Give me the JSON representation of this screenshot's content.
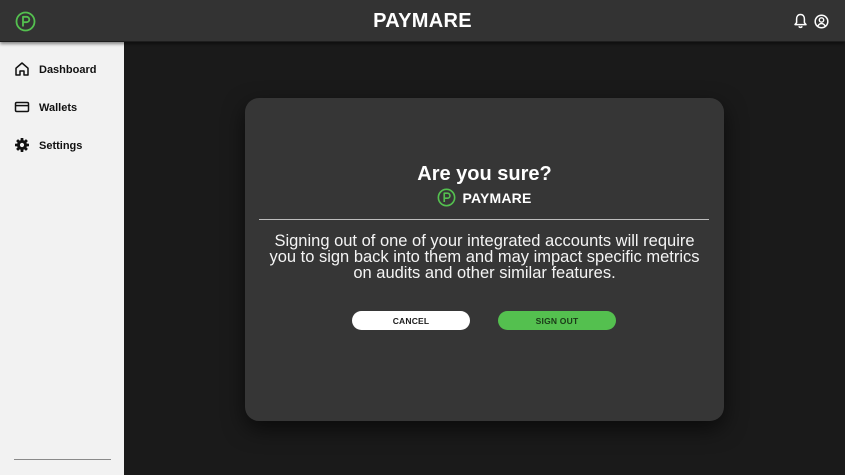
{
  "header": {
    "app_title": "PAYMARE",
    "logo_icon": "paymare-logo-icon",
    "notification_icon": "bell-icon",
    "account_icon": "user-circle-icon"
  },
  "sidebar": {
    "items": [
      {
        "label": "Dashboard",
        "icon": "home-icon"
      },
      {
        "label": "Wallets",
        "icon": "credit-card-icon"
      },
      {
        "label": "Settings",
        "icon": "gear-icon"
      }
    ]
  },
  "modal": {
    "title": "Are you sure?",
    "brand": "PAYMARE",
    "message": "Signing out of one of your integrated accounts will require you to sign back into them and may impact specific metrics on audits and other similar features.",
    "cancel_label": "CANCEL",
    "confirm_label": "SIGN OUT"
  },
  "colors": {
    "accent": "#54c04f",
    "topbar": "#333333",
    "background": "#1a1a1a",
    "sidebar": "#f2f2f2",
    "modal": "#363636"
  }
}
